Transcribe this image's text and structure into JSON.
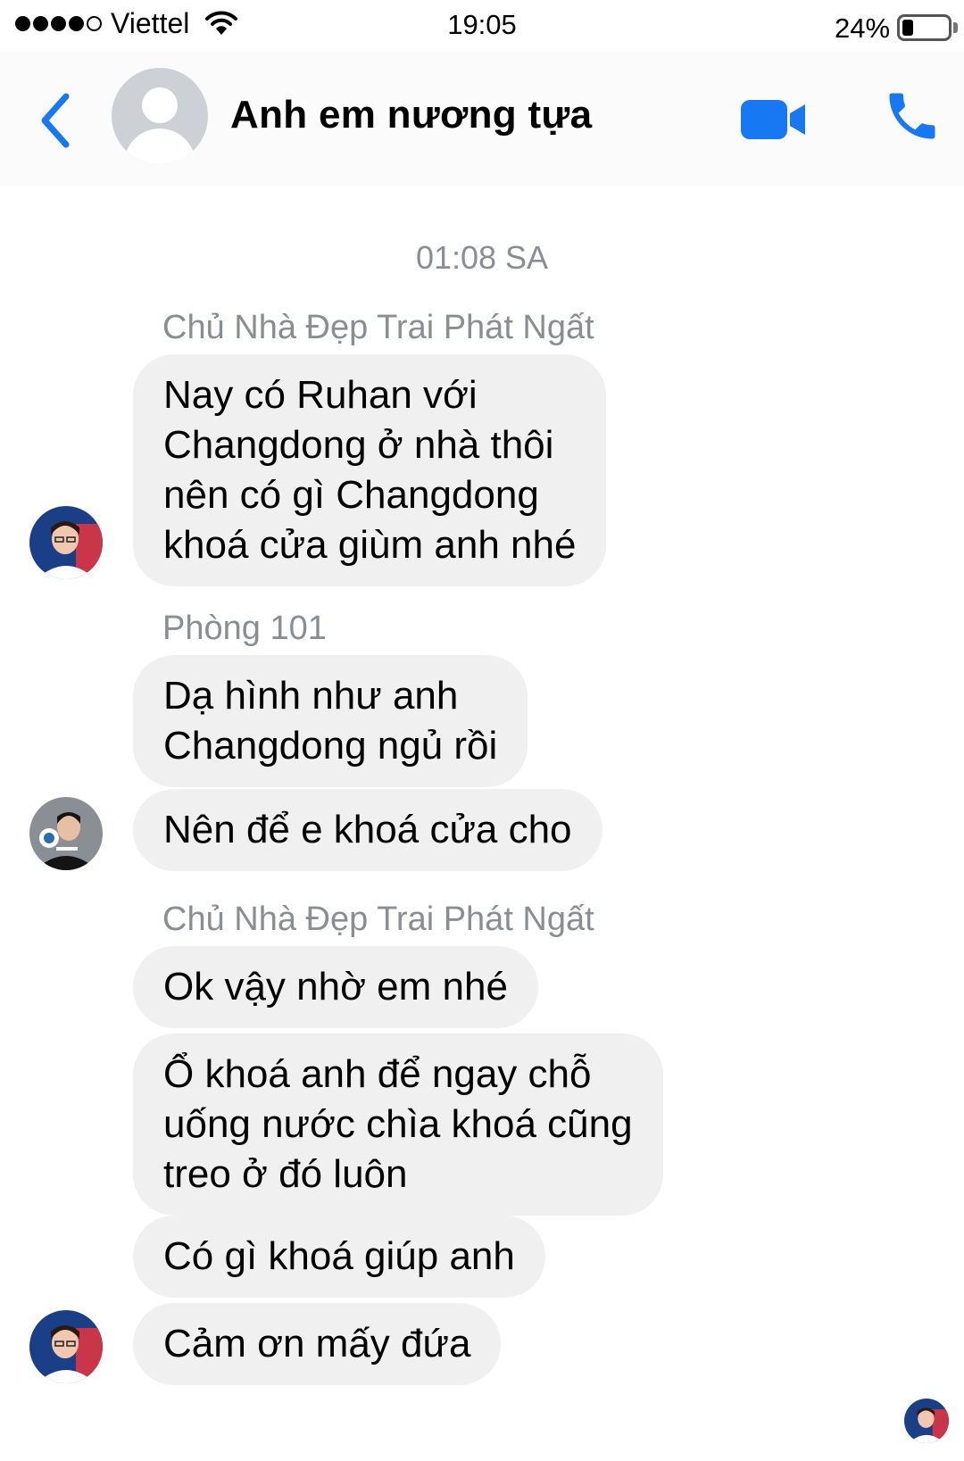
{
  "status_bar": {
    "carrier": "Viettel",
    "time": "19:05",
    "battery_percent": "24%",
    "battery_level": 0.24,
    "signal_bars_filled": 4,
    "signal_bars_total": 5
  },
  "header": {
    "title": "Anh em nương tựa",
    "back_icon": "chevron-left-icon",
    "video_icon": "video-camera-icon",
    "call_icon": "phone-icon",
    "accent_color": "#1877f2"
  },
  "thread": {
    "timestamp": "01:08 SA",
    "groups": [
      {
        "sender": "Chủ Nhà Đẹp Trai Phát Ngất",
        "messages": [
          [
            "Nay có Ruhan với",
            "Changdong ở nhà thôi",
            "nên có gì Changdong",
            "khoá cửa giùm anh nhé"
          ]
        ]
      },
      {
        "sender": "Phòng 101",
        "messages": [
          [
            "Dạ hình như anh",
            "Changdong ngủ rồi"
          ],
          [
            "Nên để e khoá cửa cho"
          ]
        ]
      },
      {
        "sender": "Chủ Nhà Đẹp Trai Phát Ngất",
        "messages": [
          [
            "Ok vậy nhờ em nhé"
          ],
          [
            "Ổ khoá anh để ngay chỗ",
            "uống nước chìa khoá cũng",
            "treo ở đó luôn"
          ],
          [
            "Có gì khoá giúp anh"
          ],
          [
            "Cảm ơn mấy đứa"
          ]
        ]
      }
    ]
  }
}
